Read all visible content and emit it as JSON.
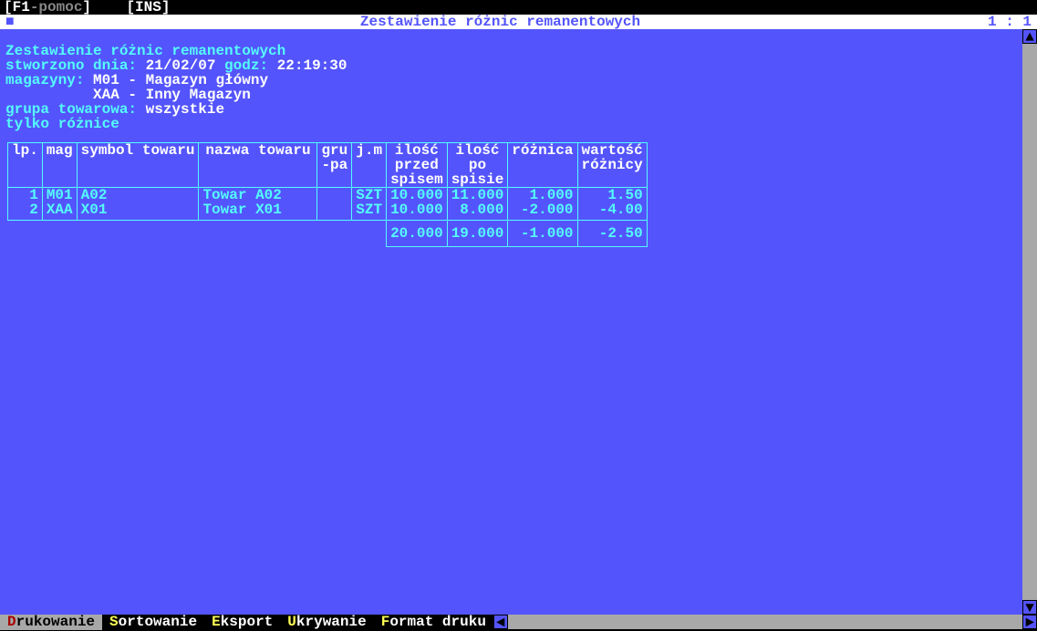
{
  "top": {
    "f1_key": "F1",
    "f1_rest": "-pomoc",
    "ins": "INS"
  },
  "titlebar": {
    "left_arrow": "■",
    "title": "Zestawienie różnic remanentowych",
    "position": "1 : 1"
  },
  "header": {
    "title": "Zestawienie różnic remanentowych",
    "created_label": "stworzono dnia: ",
    "created_date": "21/02/07",
    "time_label": " godz: ",
    "created_time": "22:19:30",
    "warehouses_label": "magazyny: ",
    "warehouse1": "M01 - Magazyn główny",
    "warehouse2": "XAA - Inny Magazyn",
    "group_label": "grupa towarowa: ",
    "group_value": "wszystkie",
    "only_diff": "tylko różnice"
  },
  "table": {
    "headers": {
      "lp": "lp.",
      "mag": "mag",
      "symbol": "symbol towaru",
      "nazwa": "nazwa towaru",
      "grupa": "gru\n-pa",
      "jm": "j.m",
      "ilosc_przed": "ilość\nprzed\nspisem",
      "ilosc_po": "ilość\npo\nspisie",
      "roznica": "różnica",
      "wartosc": "wartość\nróżnicy"
    },
    "rows": [
      {
        "lp": "1",
        "mag": "M01",
        "symbol": "A02",
        "nazwa": "Towar A02",
        "grupa": "",
        "jm": "SZT",
        "przed": "10.000",
        "po": "11.000",
        "roznica": "1.000",
        "wartosc": "1.50"
      },
      {
        "lp": "2",
        "mag": "XAA",
        "symbol": "X01",
        "nazwa": "Towar X01",
        "grupa": "",
        "jm": "SZT",
        "przed": "10.000",
        "po": "8.000",
        "roznica": "-2.000",
        "wartosc": "-4.00"
      }
    ],
    "totals": {
      "przed": "20.000",
      "po": "19.000",
      "roznica": "-1.000",
      "wartosc": "-2.50"
    }
  },
  "menu": {
    "items": [
      {
        "hotkey": "D",
        "rest": "rukowanie",
        "selected": true
      },
      {
        "hotkey": "S",
        "rest": "ortowanie",
        "selected": false
      },
      {
        "hotkey": "E",
        "rest": "ksport",
        "selected": false
      },
      {
        "hotkey": "U",
        "rest": "krywanie",
        "selected": false
      },
      {
        "hotkey": "F",
        "rest": "ormat druku",
        "selected": false
      }
    ]
  }
}
